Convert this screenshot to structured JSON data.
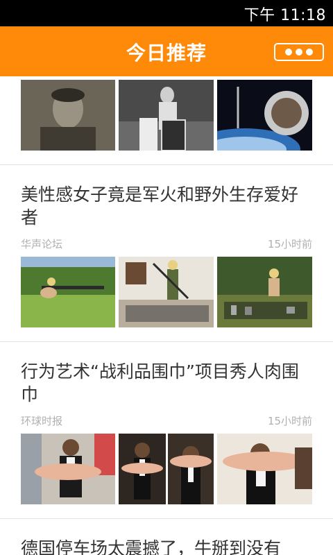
{
  "status_bar": {
    "time": "下午 11:18"
  },
  "header": {
    "title": "今日推荐"
  },
  "articles": [
    {
      "title": "",
      "source": "",
      "time": ""
    },
    {
      "title": "美性感女子竟是军火和野外生存爱好者",
      "source": "华声论坛",
      "time": "15小时前"
    },
    {
      "title": "行为艺术“战利品围巾”项目秀人肉围巾",
      "source": "环球时报",
      "time": "15小时前"
    },
    {
      "title": "德国停车场太震撼了，牛掰到没有",
      "source": "",
      "time": ""
    }
  ],
  "colors": {
    "header": "#ff8a0a",
    "status_bar": "#000000",
    "title_text": "#333333",
    "meta_text": "#b0b0b0"
  }
}
